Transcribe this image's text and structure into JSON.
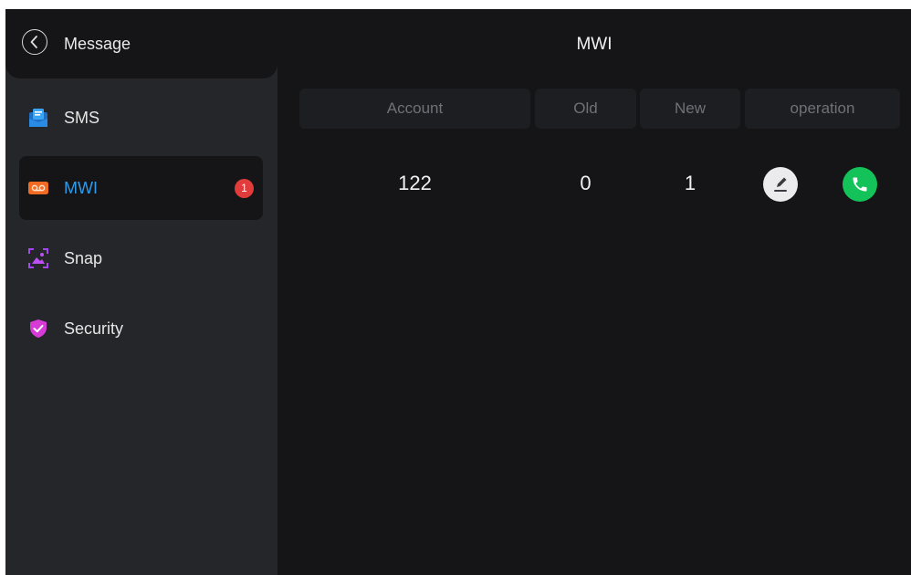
{
  "sidebar": {
    "title": "Message",
    "items": [
      {
        "label": "SMS",
        "icon": "sms-icon"
      },
      {
        "label": "MWI",
        "icon": "voicemail-icon",
        "badge": "1",
        "active": true
      },
      {
        "label": "Snap",
        "icon": "snapshot-icon"
      },
      {
        "label": "Security",
        "icon": "shield-check-icon"
      }
    ]
  },
  "main": {
    "title": "MWI",
    "columns": [
      "Account",
      "Old",
      "New",
      "operation"
    ],
    "rows": [
      {
        "account": "122",
        "old": "0",
        "new": "1",
        "operations": [
          "edit-icon",
          "phone-call-icon"
        ]
      }
    ]
  },
  "colors": {
    "accent": "#2f9bea",
    "badge": "#e23b3b",
    "call": "#14c25a",
    "background": "#151517",
    "sidebar": "#24262a"
  }
}
